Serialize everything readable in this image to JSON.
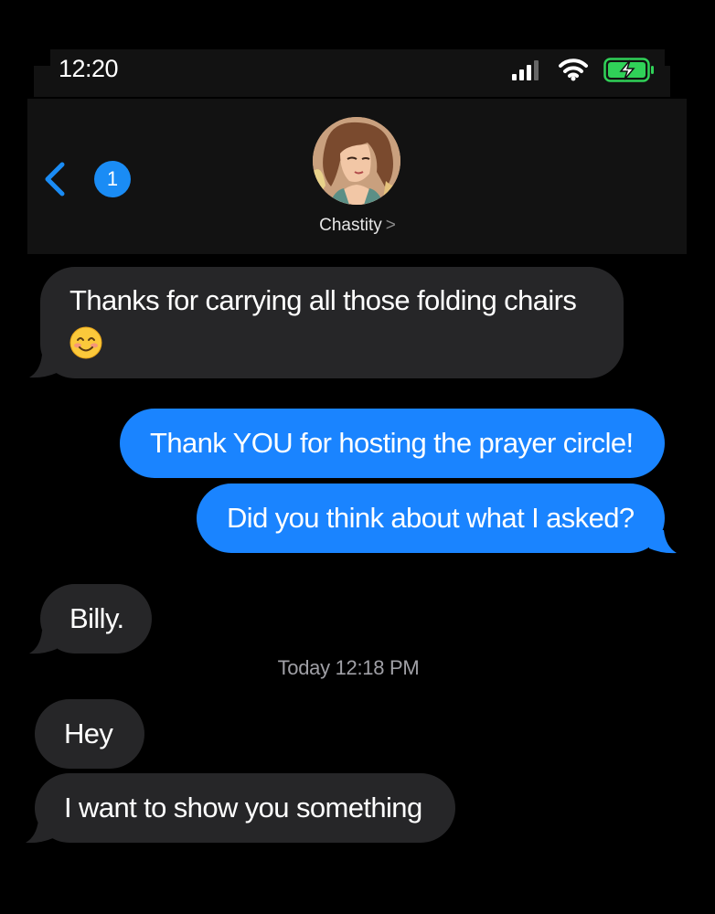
{
  "status_bar": {
    "time": "12:20",
    "signal_icon": "signal-icon",
    "wifi_icon": "wifi-icon",
    "battery_icon": "battery-charging-icon",
    "battery_color": "#30d158"
  },
  "header": {
    "back_icon": "chevron-left-icon",
    "unread_count": "1",
    "contact_name": "Chastity",
    "contact_chevron": ">"
  },
  "messages": [
    {
      "direction": "incoming",
      "text": "Thanks for carrying all those folding chairs",
      "emoji": "smiling-face-icon"
    },
    {
      "direction": "outgoing",
      "text": "Thank YOU for hosting the prayer circle!"
    },
    {
      "direction": "outgoing",
      "text": "Did you think about what I asked?"
    },
    {
      "direction": "incoming",
      "text": "Billy."
    },
    {
      "direction": "incoming",
      "text": "Hey"
    },
    {
      "direction": "incoming",
      "text": "I want to show you something"
    }
  ],
  "timestamp": "Today 12:18 PM",
  "colors": {
    "outgoing_bubble": "#1a84ff",
    "incoming_bubble": "#262628",
    "accent": "#1a8cf5"
  }
}
